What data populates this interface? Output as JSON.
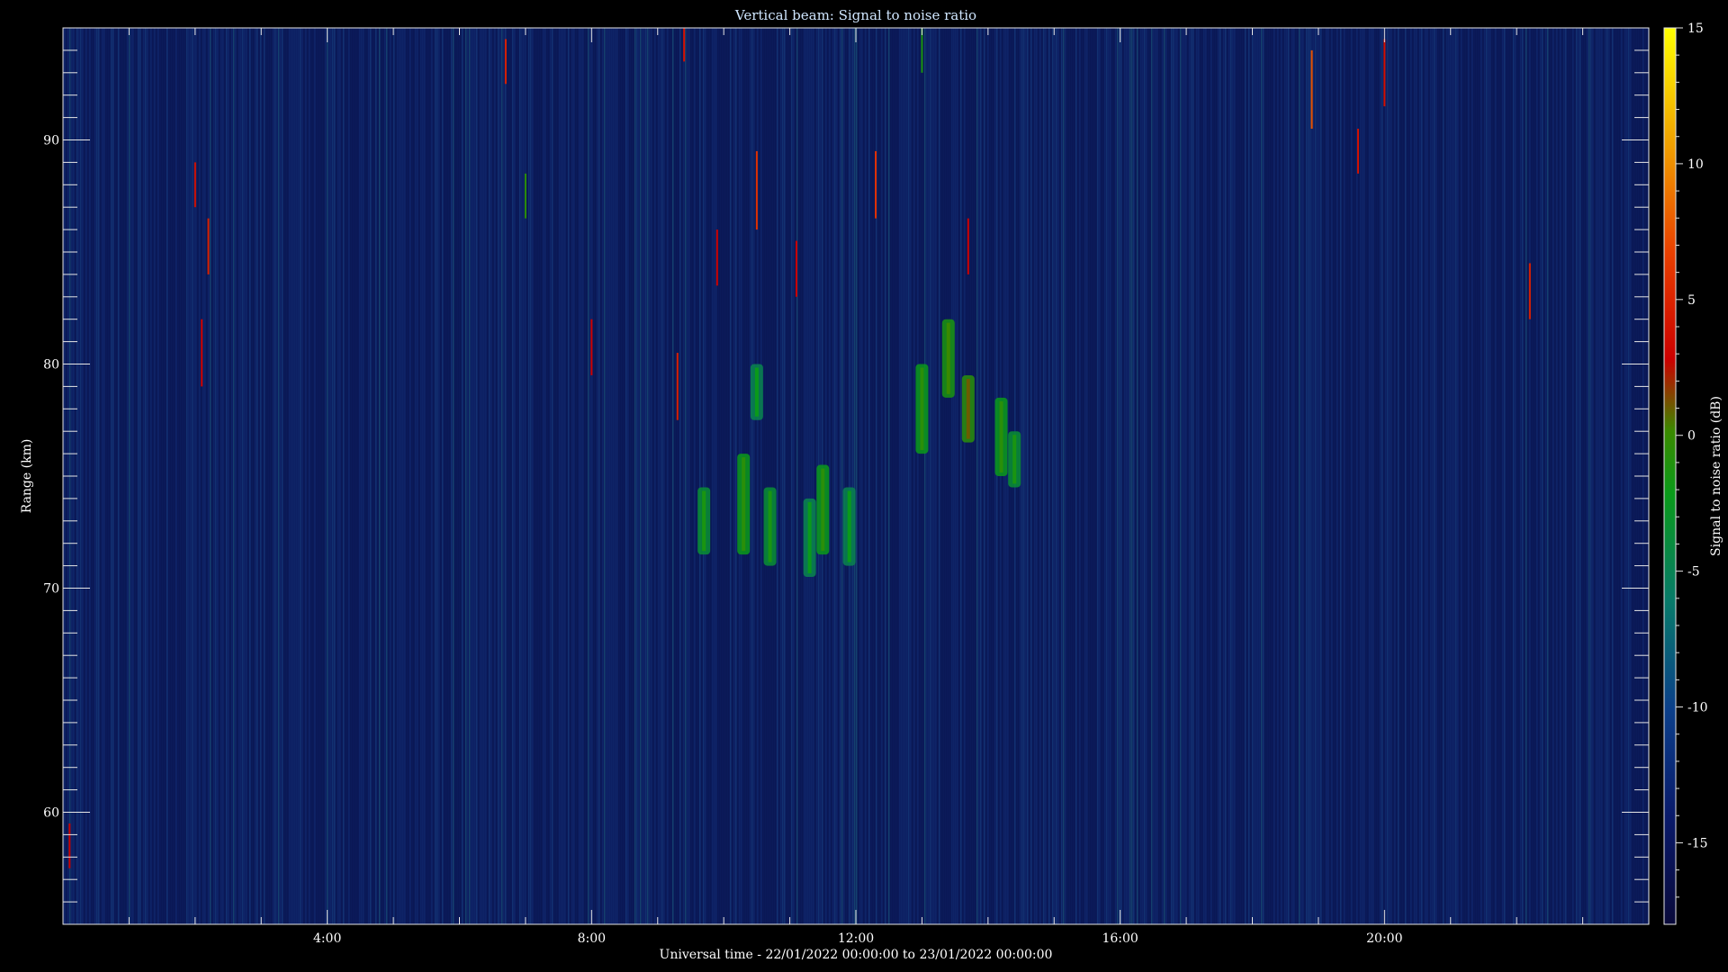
{
  "chart_data": {
    "type": "heatmap",
    "title": "Vertical beam: Signal to noise ratio",
    "xlabel": "Universal time - 22/01/2022 00:00:00 to 23/01/2022 00:00:00",
    "ylabel": "Range (km)",
    "colorbar_label": "Signal to noise ratio (dB)",
    "x_unit": "hours UT",
    "xlim": [
      0,
      24
    ],
    "ylim": [
      55,
      95
    ],
    "clim": [
      -18,
      15
    ],
    "x_ticks": [
      {
        "value": 4,
        "label": "4:00"
      },
      {
        "value": 8,
        "label": "8:00"
      },
      {
        "value": 12,
        "label": "12:00"
      },
      {
        "value": 16,
        "label": "16:00"
      },
      {
        "value": 20,
        "label": "20:00"
      }
    ],
    "y_ticks": [
      {
        "value": 60,
        "label": "60"
      },
      {
        "value": 70,
        "label": "70"
      },
      {
        "value": 80,
        "label": "80"
      },
      {
        "value": 90,
        "label": "90"
      }
    ],
    "colorbar_ticks": [
      {
        "value": 15,
        "label": "15"
      },
      {
        "value": 10,
        "label": "10"
      },
      {
        "value": 5,
        "label": "5"
      },
      {
        "value": 0,
        "label": "0"
      },
      {
        "value": -5,
        "label": "-5"
      },
      {
        "value": -10,
        "label": "-10"
      },
      {
        "value": -15,
        "label": "-15"
      }
    ],
    "background_snr_db": -15,
    "echo_patches": [
      {
        "t": 9.7,
        "r0": 71.5,
        "r1": 74.5,
        "snr": -6
      },
      {
        "t": 10.3,
        "r0": 71.5,
        "r1": 76.0,
        "snr": -5
      },
      {
        "t": 10.5,
        "r0": 77.5,
        "r1": 80.0,
        "snr": -7
      },
      {
        "t": 10.7,
        "r0": 71.0,
        "r1": 74.5,
        "snr": -6
      },
      {
        "t": 11.3,
        "r0": 70.5,
        "r1": 74.0,
        "snr": -7
      },
      {
        "t": 11.5,
        "r0": 71.5,
        "r1": 75.5,
        "snr": -5
      },
      {
        "t": 11.9,
        "r0": 71.0,
        "r1": 74.5,
        "snr": -7
      },
      {
        "t": 13.0,
        "r0": 76.0,
        "r1": 80.0,
        "snr": -5
      },
      {
        "t": 13.4,
        "r0": 78.5,
        "r1": 82.0,
        "snr": -4
      },
      {
        "t": 13.7,
        "r0": 76.5,
        "r1": 79.5,
        "snr": -3
      },
      {
        "t": 14.2,
        "r0": 75.0,
        "r1": 78.5,
        "snr": -5
      },
      {
        "t": 14.4,
        "r0": 74.5,
        "r1": 77.0,
        "snr": -6
      }
    ],
    "spikes": [
      {
        "t": 0.1,
        "r0": 57.5,
        "r1": 59.5,
        "snr": 1
      },
      {
        "t": 2.0,
        "r0": 87.0,
        "r1": 89.0,
        "snr": 2
      },
      {
        "t": 2.2,
        "r0": 84.0,
        "r1": 86.5,
        "snr": 3
      },
      {
        "t": 2.1,
        "r0": 79.0,
        "r1": 82.0,
        "snr": 1
      },
      {
        "t": 6.7,
        "r0": 92.5,
        "r1": 94.5,
        "snr": 3
      },
      {
        "t": 7.0,
        "r0": 86.5,
        "r1": 88.5,
        "snr": -3
      },
      {
        "t": 8.0,
        "r0": 79.5,
        "r1": 82.0,
        "snr": 1
      },
      {
        "t": 9.3,
        "r0": 77.5,
        "r1": 80.5,
        "snr": 3
      },
      {
        "t": 9.4,
        "r0": 93.5,
        "r1": 95.0,
        "snr": 2
      },
      {
        "t": 9.9,
        "r0": 83.5,
        "r1": 86.0,
        "snr": 1
      },
      {
        "t": 10.5,
        "r0": 86.0,
        "r1": 89.5,
        "snr": 4
      },
      {
        "t": 11.1,
        "r0": 83.0,
        "r1": 85.5,
        "snr": 1
      },
      {
        "t": 12.3,
        "r0": 86.5,
        "r1": 89.5,
        "snr": 4
      },
      {
        "t": 13.0,
        "r0": 93.0,
        "r1": 95.0,
        "snr": -4
      },
      {
        "t": 13.7,
        "r0": 84.0,
        "r1": 86.5,
        "snr": 1
      },
      {
        "t": 18.9,
        "r0": 90.5,
        "r1": 94.0,
        "snr": 6
      },
      {
        "t": 19.6,
        "r0": 88.5,
        "r1": 90.5,
        "snr": 2
      },
      {
        "t": 20.0,
        "r0": 91.5,
        "r1": 94.5,
        "snr": 2
      },
      {
        "t": 22.2,
        "r0": 82.0,
        "r1": 84.5,
        "snr": 3
      }
    ]
  }
}
